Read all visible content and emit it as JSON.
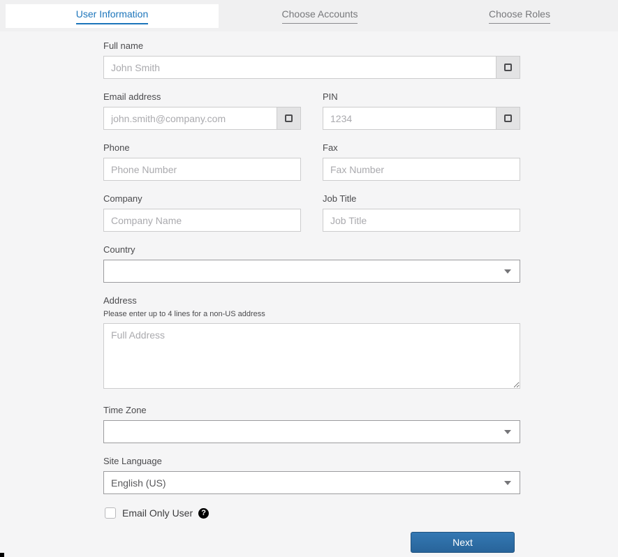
{
  "tabs": [
    {
      "label": "User Information",
      "active": true
    },
    {
      "label": "Choose Accounts",
      "active": false
    },
    {
      "label": "Choose Roles",
      "active": false
    }
  ],
  "form": {
    "full_name": {
      "label": "Full name",
      "value": "",
      "placeholder": "John Smith"
    },
    "email": {
      "label": "Email address",
      "value": "",
      "placeholder": "john.smith@company.com"
    },
    "pin": {
      "label": "PIN",
      "value": "",
      "placeholder": "1234"
    },
    "phone": {
      "label": "Phone",
      "value": "",
      "placeholder": "Phone Number"
    },
    "fax": {
      "label": "Fax",
      "value": "",
      "placeholder": "Fax Number"
    },
    "company": {
      "label": "Company",
      "value": "",
      "placeholder": "Company Name"
    },
    "job_title": {
      "label": "Job Title",
      "value": "",
      "placeholder": "Job Title"
    },
    "country": {
      "label": "Country",
      "value": ""
    },
    "address": {
      "label": "Address",
      "hint": "Please enter up to 4 lines for a non-US address",
      "value": "",
      "placeholder": "Full Address"
    },
    "time_zone": {
      "label": "Time Zone",
      "value": ""
    },
    "site_language": {
      "label": "Site Language",
      "value": "English (US)"
    },
    "email_only_user": {
      "label": "Email Only User",
      "checked": false,
      "help_glyph": "?"
    },
    "next_button_label": "Next"
  },
  "icons": {
    "input_addon": "square-outline-icon",
    "select_caret": "chevron-down-icon",
    "help": "question-mark-icon"
  },
  "colors": {
    "accent_blue": "#1c75bb",
    "inactive_tab_gray": "#77787b",
    "button_blue": "#2e6da4",
    "input_border": "#cccccd",
    "select_border": "#9b9b9e",
    "page_background": "#f5f5f6"
  }
}
